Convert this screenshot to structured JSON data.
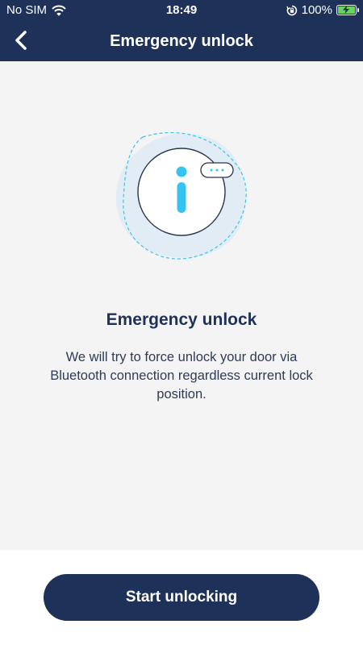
{
  "status_bar": {
    "carrier": "No SIM",
    "time": "18:49",
    "battery_percent": "100%",
    "icons": [
      "wifi-icon",
      "orientation-lock-icon",
      "battery-charging-icon"
    ]
  },
  "header": {
    "title": "Emergency unlock",
    "back_icon": "chevron-left-icon"
  },
  "content": {
    "illustration_icon": "info-icon",
    "title": "Emergency unlock",
    "description": "We will try to force unlock your door via Bluetooth connection regardless current lock position."
  },
  "footer": {
    "primary_button_label": "Start unlocking"
  },
  "colors": {
    "navy": "#1e3158",
    "accent_blue": "#35c4f2",
    "background": "#f4f4f4",
    "battery_green": "#6bd35b"
  }
}
